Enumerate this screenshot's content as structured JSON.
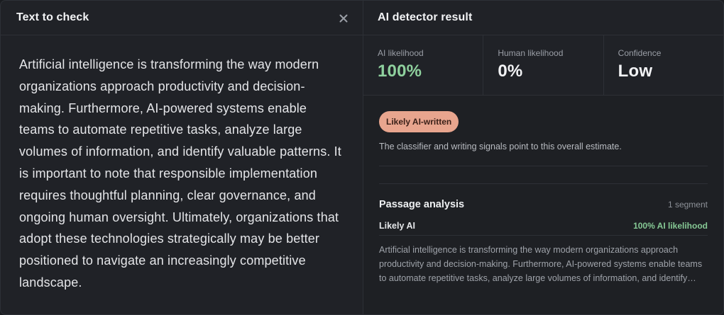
{
  "left_panel": {
    "title": "Text to check",
    "close_icon": "close-icon",
    "text": "Artificial intelligence is transforming the way modern organizations approach productivity and decision-making. Furthermore, AI-powered systems enable teams to automate repetitive tasks, analyze large volumes of information, and identify valuable patterns. It is important to note that responsible implementation requires thoughtful planning, clear governance, and ongoing human oversight. Ultimately, organizations that adopt these technologies strategically may be better positioned to navigate an increasingly competitive landscape."
  },
  "right_panel": {
    "title": "AI detector result",
    "stats": [
      {
        "label": "AI likelihood",
        "value": "100%"
      },
      {
        "label": "Human likelihood",
        "value": "0%"
      },
      {
        "label": "Confidence",
        "value": "Low"
      }
    ],
    "badge": "Likely AI-written",
    "summary": "The classifier and writing signals point to this overall estimate.",
    "passage_analysis": {
      "title": "Passage analysis",
      "segment_count": "1 segment",
      "segments": [
        {
          "label": "Likely AI",
          "likelihood": "100% AI likelihood",
          "text": "Artificial intelligence is transforming the way modern organizations approach productivity and decision-making. Furthermore, AI-powered systems enable teams to automate repetitive tasks, analyze large volumes of information, and identify valuable patterns. It is important to note that responsible implementation requires thoughtful planning, clear governance, and ongoing human oversight. Ultimately, organizations that adopt these technologies strategically may be better positioned to navigate an increasingly competitive landscape."
        }
      ]
    }
  },
  "colors": {
    "background": "#202227",
    "accent_green": "#8fd19e",
    "badge_bg": "#e8a58e",
    "badge_text": "#3a2018"
  }
}
